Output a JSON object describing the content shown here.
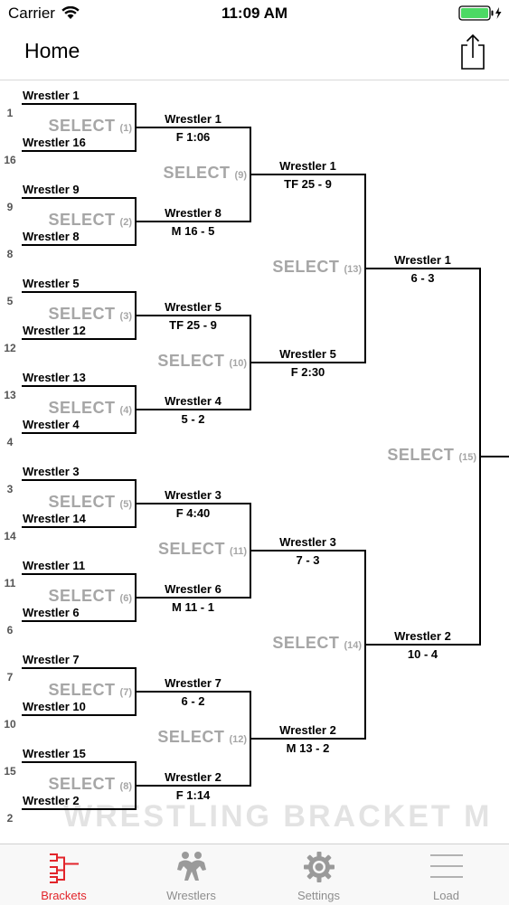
{
  "status": {
    "carrier": "Carrier",
    "time": "11:09 AM"
  },
  "nav": {
    "title": "Home"
  },
  "select_label": "SELECT",
  "round1": [
    {
      "top": {
        "name": "Wrestler 1",
        "seed": "1"
      },
      "bottom": {
        "name": "Wrestler 16",
        "seed": "16"
      },
      "match": "(1)"
    },
    {
      "top": {
        "name": "Wrestler 9",
        "seed": "9"
      },
      "bottom": {
        "name": "Wrestler 8",
        "seed": "8"
      },
      "match": "(2)"
    },
    {
      "top": {
        "name": "Wrestler 5",
        "seed": "5"
      },
      "bottom": {
        "name": "Wrestler 12",
        "seed": "12"
      },
      "match": "(3)"
    },
    {
      "top": {
        "name": "Wrestler 13",
        "seed": "13"
      },
      "bottom": {
        "name": "Wrestler 4",
        "seed": "4"
      },
      "match": "(4)"
    },
    {
      "top": {
        "name": "Wrestler 3",
        "seed": "3"
      },
      "bottom": {
        "name": "Wrestler 14",
        "seed": "14"
      },
      "match": "(5)"
    },
    {
      "top": {
        "name": "Wrestler 11",
        "seed": "11"
      },
      "bottom": {
        "name": "Wrestler 6",
        "seed": "6"
      },
      "match": "(6)"
    },
    {
      "top": {
        "name": "Wrestler 7",
        "seed": "7"
      },
      "bottom": {
        "name": "Wrestler 10",
        "seed": "10"
      },
      "match": "(7)"
    },
    {
      "top": {
        "name": "Wrestler 15",
        "seed": "15"
      },
      "bottom": {
        "name": "Wrestler 2",
        "seed": "2"
      },
      "match": "(8)"
    }
  ],
  "round2": [
    {
      "top": {
        "name": "Wrestler 1",
        "result": "F 1:06"
      },
      "bottom": {
        "name": "Wrestler 8",
        "result": "M 16 - 5"
      },
      "match": "(9)"
    },
    {
      "top": {
        "name": "Wrestler 5",
        "result": "TF 25 - 9"
      },
      "bottom": {
        "name": "Wrestler 4",
        "result": "5 - 2"
      },
      "match": "(10)"
    },
    {
      "top": {
        "name": "Wrestler 3",
        "result": "F 4:40"
      },
      "bottom": {
        "name": "Wrestler 6",
        "result": "M 11 - 1"
      },
      "match": "(11)"
    },
    {
      "top": {
        "name": "Wrestler 7",
        "result": "6 - 2"
      },
      "bottom": {
        "name": "Wrestler 2",
        "result": "F 1:14"
      },
      "match": "(12)"
    }
  ],
  "round3": [
    {
      "top": {
        "name": "Wrestler 1",
        "result": "TF 25 - 9"
      },
      "bottom": {
        "name": "Wrestler 5",
        "result": "F 2:30"
      },
      "match": "(13)"
    },
    {
      "top": {
        "name": "Wrestler 3",
        "result": "7 - 3"
      },
      "bottom": {
        "name": "Wrestler 2",
        "result": "M 13 - 2"
      },
      "match": "(14)"
    }
  ],
  "round4": [
    {
      "top": {
        "name": "Wrestler 1",
        "result": "6 - 3"
      },
      "bottom": {
        "name": "Wrestler 2",
        "result": "10 - 4"
      },
      "match": "(15)"
    }
  ],
  "watermark": "WRESTLING BRACKET M",
  "tabs": [
    {
      "label": "Brackets",
      "icon": "brackets-icon",
      "active": true
    },
    {
      "label": "Wrestlers",
      "icon": "wrestlers-icon",
      "active": false
    },
    {
      "label": "Settings",
      "icon": "gear-icon",
      "active": false
    },
    {
      "label": "Load",
      "icon": "load-icon",
      "active": false
    }
  ],
  "colors": {
    "accent": "#e2252b",
    "select_text": "#a6a6a6",
    "battery": "#4cd964"
  }
}
